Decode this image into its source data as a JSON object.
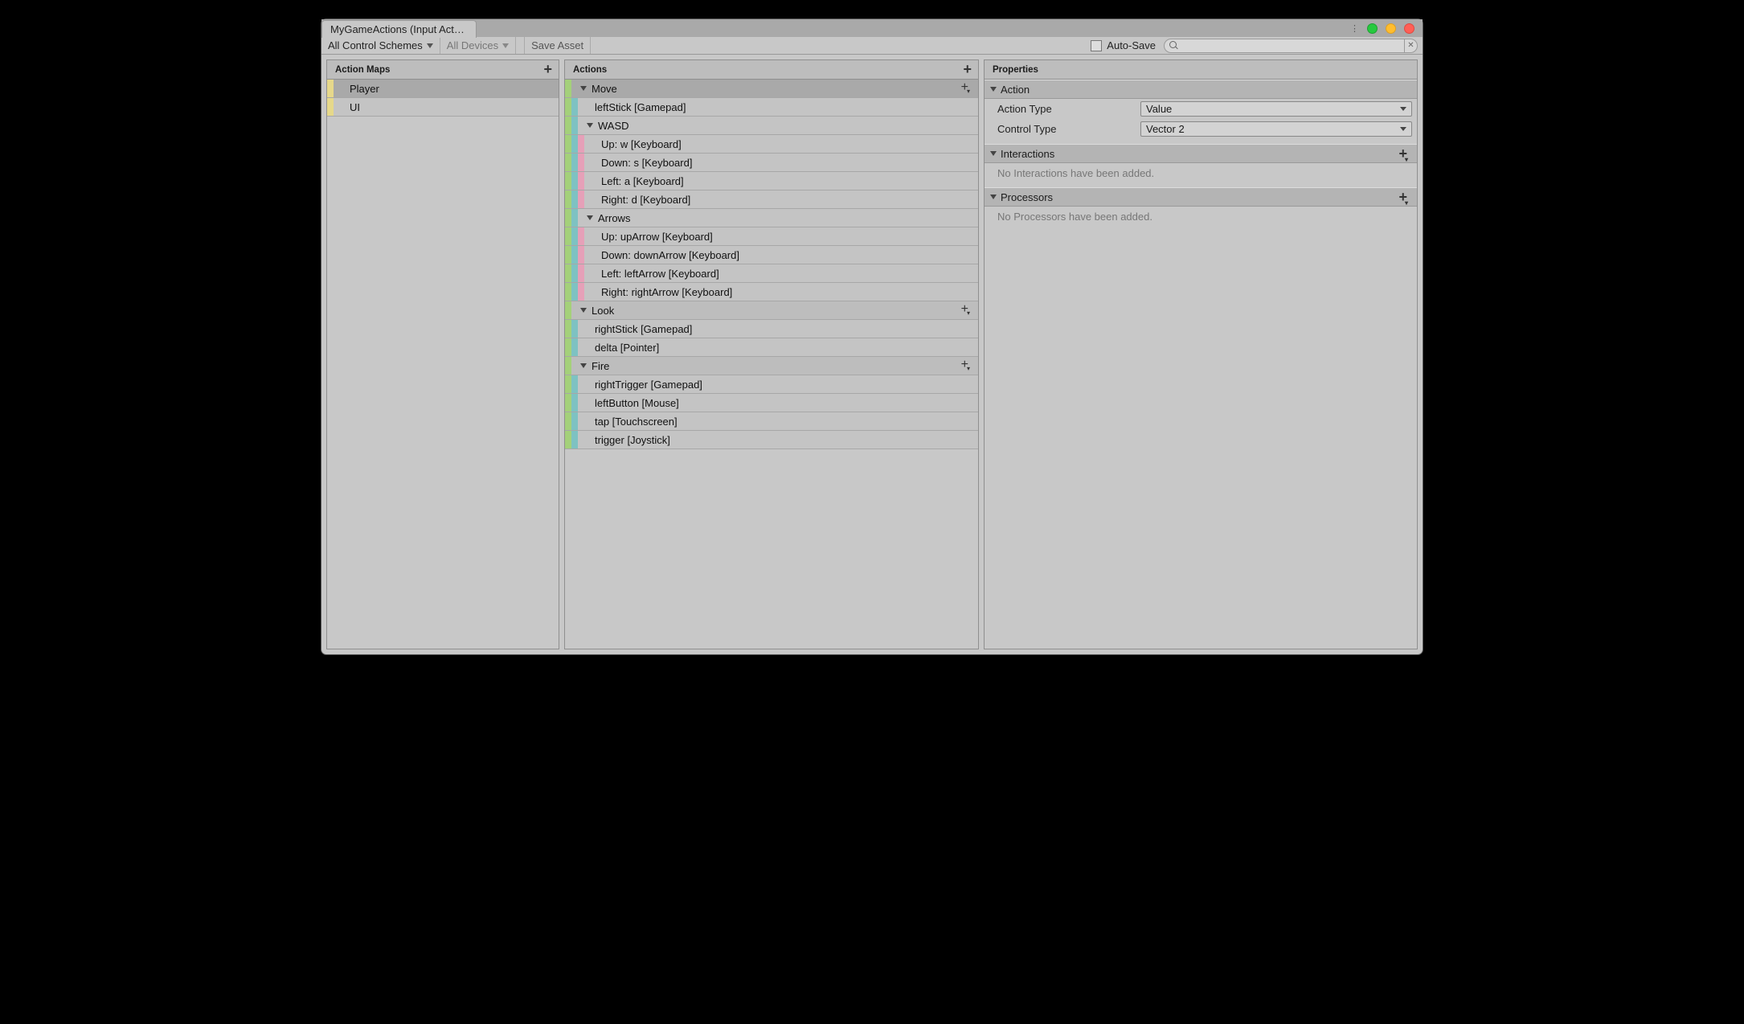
{
  "tab": {
    "title": "MyGameActions (Input Act…"
  },
  "toolbar": {
    "scheme": "All Control Schemes",
    "devices": "All Devices",
    "save": "Save Asset",
    "autosave": "Auto-Save"
  },
  "panels": {
    "maps": {
      "title": "Action Maps"
    },
    "actions": {
      "title": "Actions"
    },
    "props": {
      "title": "Properties"
    }
  },
  "action_maps": [
    {
      "name": "Player",
      "selected": true
    },
    {
      "name": "UI",
      "selected": false
    }
  ],
  "selected_action": "Move",
  "actions_tree": [
    {
      "type": "action",
      "name": "Move",
      "selected": true,
      "children": [
        {
          "type": "binding",
          "name": "leftStick [Gamepad]"
        },
        {
          "type": "composite",
          "name": "WASD",
          "children": [
            {
              "type": "part",
              "name": "Up: w [Keyboard]"
            },
            {
              "type": "part",
              "name": "Down: s [Keyboard]"
            },
            {
              "type": "part",
              "name": "Left: a [Keyboard]"
            },
            {
              "type": "part",
              "name": "Right: d [Keyboard]"
            }
          ]
        },
        {
          "type": "composite",
          "name": "Arrows",
          "children": [
            {
              "type": "part",
              "name": "Up: upArrow [Keyboard]"
            },
            {
              "type": "part",
              "name": "Down: downArrow [Keyboard]"
            },
            {
              "type": "part",
              "name": "Left: leftArrow [Keyboard]"
            },
            {
              "type": "part",
              "name": "Right: rightArrow [Keyboard]"
            }
          ]
        }
      ]
    },
    {
      "type": "action",
      "name": "Look",
      "children": [
        {
          "type": "binding",
          "name": "rightStick [Gamepad]"
        },
        {
          "type": "binding",
          "name": "delta [Pointer]"
        }
      ]
    },
    {
      "type": "action",
      "name": "Fire",
      "children": [
        {
          "type": "binding",
          "name": "rightTrigger [Gamepad]"
        },
        {
          "type": "binding",
          "name": "leftButton [Mouse]"
        },
        {
          "type": "binding",
          "name": "tap [Touchscreen]"
        },
        {
          "type": "binding",
          "name": "trigger [Joystick]"
        }
      ]
    }
  ],
  "properties": {
    "action": {
      "heading": "Action",
      "rows": [
        {
          "label": "Action Type",
          "value": "Value"
        },
        {
          "label": "Control Type",
          "value": "Vector 2"
        }
      ]
    },
    "interactions": {
      "heading": "Interactions",
      "empty": "No Interactions have been added."
    },
    "processors": {
      "heading": "Processors",
      "empty": "No Processors have been added."
    }
  }
}
